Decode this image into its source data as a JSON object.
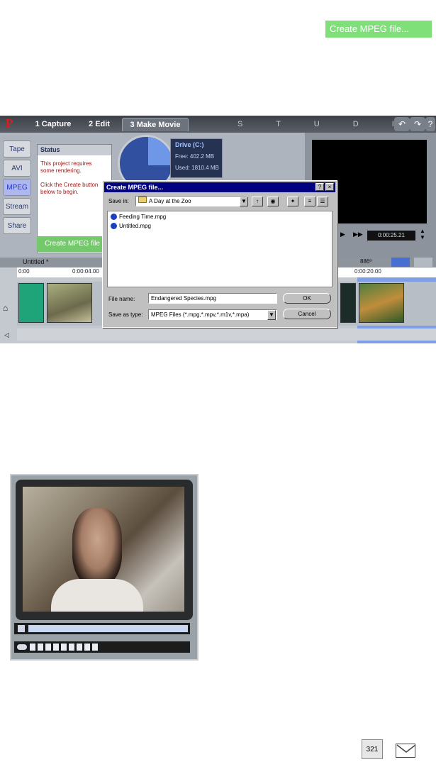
{
  "top_button": {
    "label": "Create MPEG file..."
  },
  "studio": {
    "logo": "P",
    "tabs": [
      "1 Capture",
      "2 Edit",
      "3 Make Movie"
    ],
    "brand": "S T U D I O",
    "top_buttons": [
      "↶",
      "↷",
      "?"
    ],
    "side_tabs": [
      "Tape",
      "AVI",
      "MPEG",
      "Stream",
      "Share"
    ],
    "status": {
      "title": "Status",
      "line1": "This project requires",
      "line2": "some rendering.",
      "line3": "Click the Create button",
      "line4": "below to begin.",
      "create_label": "Create MPEG file"
    },
    "drive": {
      "title": "Drive (C:)",
      "free": "Free:   402.2 MB",
      "used": "Used:  1810.4 MB"
    },
    "timecode": "0:00:25.21",
    "timeline": {
      "project_name": "Untitled *",
      "ruler": [
        "0:00",
        "0:00:04.00",
        "0:00:20.00"
      ],
      "tool_label": "886º"
    }
  },
  "dialog": {
    "title": "Create MPEG file...",
    "save_in_label": "Save in:",
    "save_in_value": "A Day at the Zoo",
    "files": [
      "Feeding Time.mpg",
      "Untitled.mpg"
    ],
    "file_name_label": "File name:",
    "file_name_value": "Endangered Species.mpg",
    "save_type_label": "Save as type:",
    "save_type_value": "MPEG Files (*.mpg,*.mpv,*.m1v,*.mpa)",
    "ok_label": "OK",
    "cancel_label": "Cancel"
  },
  "bottom_icons": {
    "clap": "321"
  }
}
